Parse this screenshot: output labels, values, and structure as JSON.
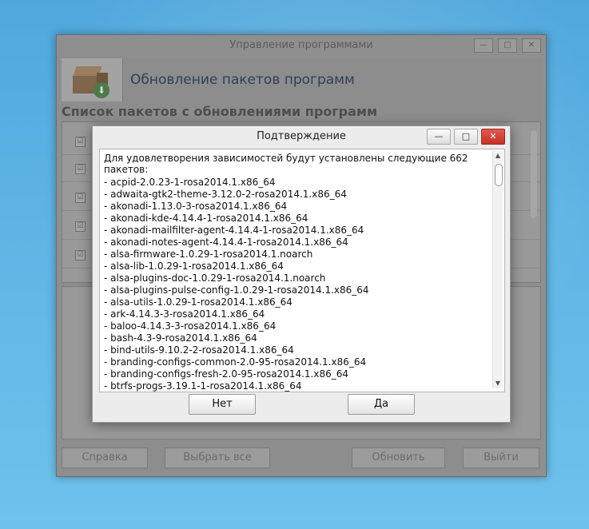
{
  "main_window": {
    "title": "Управление программами",
    "controls": {
      "minimize": "—",
      "maximize": "□",
      "close": "✕"
    },
    "heading": "Обновление пакетов программ",
    "section_title": "Список пакетов с обновлениями программ",
    "row_check": "☑",
    "download_arrow": "⬇",
    "buttons": {
      "help": "Справка",
      "select_all": "Выбрать все",
      "update": "Обновить",
      "quit": "Выйти"
    }
  },
  "dialog": {
    "title": "Подтверждение",
    "controls": {
      "minimize": "—",
      "maximize": "□",
      "close": "✕"
    },
    "message": "Для удовлетворения зависимостей будут установлены следующие 662 пакетов:",
    "packages": [
      "- acpid-2.0.23-1-rosa2014.1.x86_64",
      "- adwaita-gtk2-theme-3.12.0-2-rosa2014.1.x86_64",
      "- akonadi-1.13.0-3-rosa2014.1.x86_64",
      "- akonadi-kde-4.14.4-1-rosa2014.1.x86_64",
      "- akonadi-mailfilter-agent-4.14.4-1-rosa2014.1.x86_64",
      "- akonadi-notes-agent-4.14.4-1-rosa2014.1.x86_64",
      "- alsa-firmware-1.0.29-1-rosa2014.1.noarch",
      "- alsa-lib-1.0.29-1-rosa2014.1.x86_64",
      "- alsa-plugins-doc-1.0.29-1-rosa2014.1.noarch",
      "- alsa-plugins-pulse-config-1.0.29-1-rosa2014.1.x86_64",
      "- alsa-utils-1.0.29-1-rosa2014.1.x86_64",
      "- ark-4.14.3-3-rosa2014.1.x86_64",
      "- baloo-4.14.3-3-rosa2014.1.x86_64",
      "- bash-4.3-9-rosa2014.1.x86_64",
      "- bind-utils-9.10.2-2-rosa2014.1.x86_64",
      "- branding-configs-common-2.0-95-rosa2014.1.x86_64",
      "- branding-configs-fresh-2.0-95-rosa2014.1.x86_64",
      "- btrfs-progs-3.19.1-1-rosa2014.1.x86_64"
    ],
    "buttons": {
      "no": "Нет",
      "yes": "Да"
    },
    "scroll": {
      "up": "▲",
      "down": "▼"
    }
  }
}
